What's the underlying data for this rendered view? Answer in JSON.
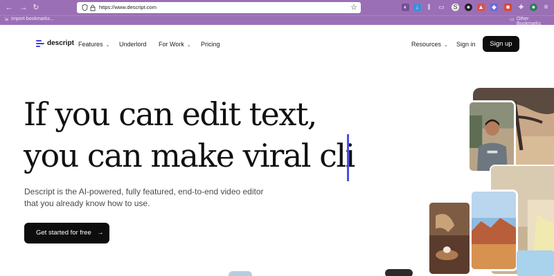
{
  "browser": {
    "url": "https://www.descript.com",
    "import_bookmarks": "Import bookmarks...",
    "other_bookmarks": "Other Bookmarks",
    "chrome_color": "#9b6fb6"
  },
  "nav": {
    "logo": "descript",
    "features": "Features",
    "underlord": "Underlord",
    "for_work": "For Work",
    "pricing": "Pricing",
    "resources": "Resources",
    "sign_in": "Sign in",
    "sign_up": "Sign up"
  },
  "hero": {
    "line1": "If you can edit text,",
    "line2": "you can make viral cli",
    "sub1": "Descript is the AI-powered, fully featured, end-to-end video editor",
    "sub2": "that you already know how to use.",
    "cta": "Get started for free",
    "cta_arrow": "→",
    "caret_color": "#4a50e6"
  },
  "icons": {
    "back": "←",
    "forward": "→",
    "reload": "↻",
    "star": "☆",
    "menu": "≡"
  }
}
